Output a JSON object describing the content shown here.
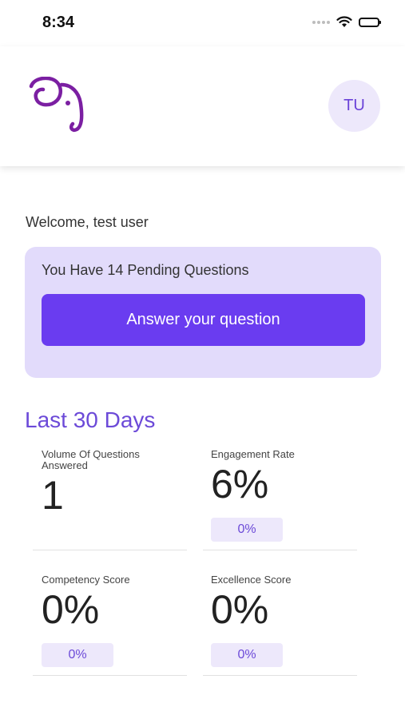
{
  "status_bar": {
    "time": "8:34"
  },
  "header": {
    "logo_icon": "elephant-logo-icon",
    "avatar_initials": "TU"
  },
  "welcome_text": "Welcome, test user",
  "pending": {
    "text": "You Have 14 Pending Questions",
    "button_label": "Answer your question"
  },
  "stats": {
    "title": "Last 30 Days",
    "metrics": [
      {
        "label": "Volume Of Questions Answered",
        "value": "1",
        "badge": ""
      },
      {
        "label": "Engagement Rate",
        "value": "6%",
        "badge": "0%"
      },
      {
        "label": "Competency Score",
        "value": "0%",
        "badge": "0%"
      },
      {
        "label": "Excellence Score",
        "value": "0%",
        "badge": "0%"
      }
    ]
  },
  "colors": {
    "accent": "#6a3cf0",
    "card_bg": "#e2dbfb",
    "badge_bg": "#ede8fb",
    "title": "#6c4ad8"
  }
}
